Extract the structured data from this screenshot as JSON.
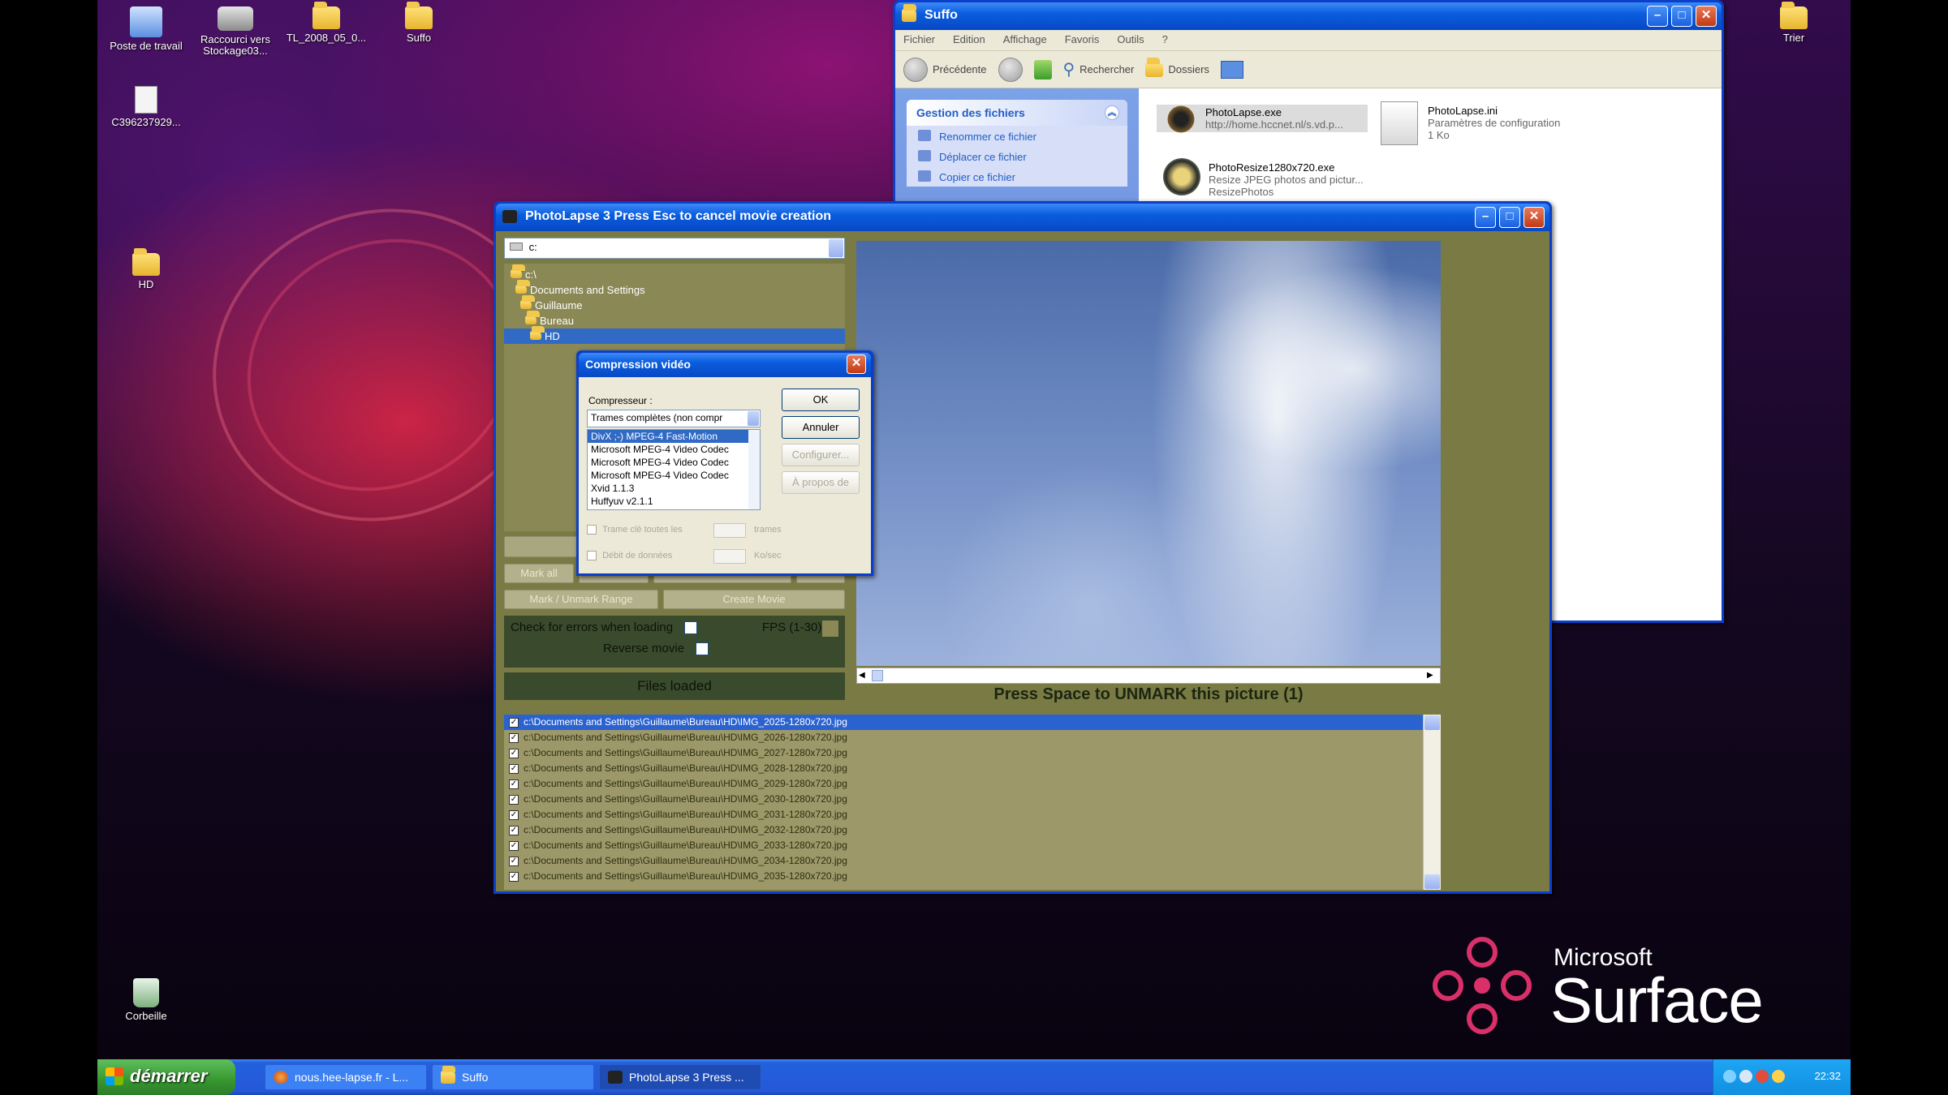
{
  "desktop": {
    "icons": [
      {
        "label": "Poste de travail"
      },
      {
        "label": "Raccourci vers Stockage03..."
      },
      {
        "label": "TL_2008_05_0..."
      },
      {
        "label": "Suffo"
      },
      {
        "label": "C396237929..."
      },
      {
        "label": "HD"
      },
      {
        "label": "Corbeille"
      },
      {
        "label": "Trier"
      }
    ]
  },
  "explorer": {
    "title": "Suffo",
    "menu": [
      "Fichier",
      "Edition",
      "Affichage",
      "Favoris",
      "Outils",
      "?"
    ],
    "toolbar": {
      "back": "Précédente",
      "search": "Rechercher",
      "folders": "Dossiers"
    },
    "taskpane": {
      "header": "Gestion des fichiers",
      "items": [
        "Renommer ce fichier",
        "Déplacer ce fichier",
        "Copier ce fichier"
      ]
    },
    "files": [
      {
        "name": "PhotoLapse.exe",
        "detail": "http://home.hccnet.nl/s.vd.p..."
      },
      {
        "name": "PhotoLapse.ini",
        "detail": "Paramètres de configuration",
        "size": "1 Ko"
      },
      {
        "name": "PhotoResize1280x720.exe",
        "detail": "Resize JPEG photos and pictur...",
        "extra": "ResizePhotos"
      }
    ]
  },
  "photolapse": {
    "title": "PhotoLapse 3  Press Esc to cancel movie creation",
    "drive": "c:",
    "tree": [
      "c:\\",
      "Documents and Settings",
      "Guillaume",
      "Bureau",
      "HD"
    ],
    "buttons": {
      "mark_unmark_range": "Mark / Unmark Range",
      "create_movie": "Create Movie",
      "mark_all": "Mark all"
    },
    "check_errors_label": "Check for errors when loading",
    "fps_label": "FPS (1-30)",
    "reverse_label": "Reverse movie",
    "files_loaded": "Files loaded",
    "press_space": "Press Space to UNMARK this picture (1)",
    "files": [
      "c:\\Documents and Settings\\Guillaume\\Bureau\\HD\\IMG_2025-1280x720.jpg",
      "c:\\Documents and Settings\\Guillaume\\Bureau\\HD\\IMG_2026-1280x720.jpg",
      "c:\\Documents and Settings\\Guillaume\\Bureau\\HD\\IMG_2027-1280x720.jpg",
      "c:\\Documents and Settings\\Guillaume\\Bureau\\HD\\IMG_2028-1280x720.jpg",
      "c:\\Documents and Settings\\Guillaume\\Bureau\\HD\\IMG_2029-1280x720.jpg",
      "c:\\Documents and Settings\\Guillaume\\Bureau\\HD\\IMG_2030-1280x720.jpg",
      "c:\\Documents and Settings\\Guillaume\\Bureau\\HD\\IMG_2031-1280x720.jpg",
      "c:\\Documents and Settings\\Guillaume\\Bureau\\HD\\IMG_2032-1280x720.jpg",
      "c:\\Documents and Settings\\Guillaume\\Bureau\\HD\\IMG_2033-1280x720.jpg",
      "c:\\Documents and Settings\\Guillaume\\Bureau\\HD\\IMG_2034-1280x720.jpg",
      "c:\\Documents and Settings\\Guillaume\\Bureau\\HD\\IMG_2035-1280x720.jpg"
    ]
  },
  "dialog": {
    "title": "Compression vidéo",
    "compressor_label": "Compresseur :",
    "selected": "Trames complètes (non compr",
    "options": [
      "DivX ;-) MPEG-4 Fast-Motion",
      "Microsoft MPEG-4 Video Codec",
      "Microsoft MPEG-4 Video Codec",
      "Microsoft MPEG-4 Video Codec",
      "Xvid 1.1.3",
      "Huffyuv v2.1.1"
    ],
    "buttons": {
      "ok": "OK",
      "cancel": "Annuler",
      "configure": "Configurer...",
      "about": "À propos de"
    },
    "keyframe_label": "Trame clé toutes les",
    "keyframe_unit": "trames",
    "datarate_label": "Débit de données",
    "datarate_unit": "Ko/sec"
  },
  "taskbar": {
    "start": "démarrer",
    "tasks": [
      "nous.hee-lapse.fr - L...",
      "Suffo",
      "PhotoLapse 3  Press ..."
    ],
    "clock": "22:32"
  },
  "brand": {
    "line1": "Microsoft",
    "line2": "Surface"
  }
}
